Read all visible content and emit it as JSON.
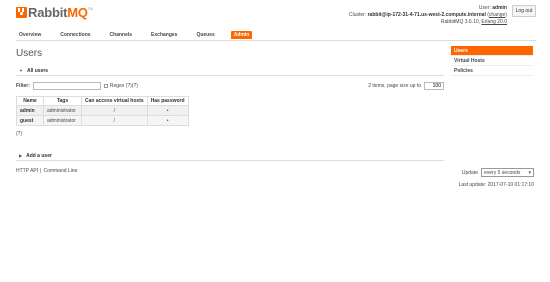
{
  "logo": {
    "text_a": "Rabbit",
    "text_b": "MQ",
    "tm": "TM"
  },
  "login": {
    "user_prefix": "User: ",
    "user": "admin",
    "cluster_prefix": "Cluster: ",
    "cluster": "rabbit@ip-172-31-4-71.us-west-2.compute.internal",
    "change_label": "change",
    "version_line": "RabbitMQ 3.6.10, ",
    "erlang": "Erlang 20.0",
    "logout_label": "Log out"
  },
  "tabs": [
    "Overview",
    "Connections",
    "Channels",
    "Exchanges",
    "Queues",
    "Admin"
  ],
  "page_title": "Users",
  "right_nav": [
    "Users",
    "Virtual Hosts",
    "Policies"
  ],
  "all_users": {
    "heading": "All users",
    "filter_label": "Filter:",
    "filter_value": "",
    "regex_label": "Regex (?)(?)",
    "items_text": "2 items, page size up to",
    "page_size": "100",
    "columns": [
      "Name",
      "Tags",
      "Can access virtual hosts",
      "Has password"
    ],
    "rows": [
      {
        "name": "admin",
        "tags": "administrator",
        "vhosts": "/",
        "has_password": "•"
      },
      {
        "name": "guest",
        "tags": "administrator",
        "vhosts": "/",
        "has_password": "•"
      }
    ],
    "help": "(?)"
  },
  "add_user": {
    "heading": "Add a user"
  },
  "footer": {
    "http_api": "HTTP API",
    "command_line": "Command Line",
    "sep": "|",
    "update_label": "Update",
    "update_value": "every 5 seconds",
    "last_update": "Last update: 2017-07-10 01:17:10"
  },
  "colors": {
    "accent": "#ff6600",
    "row_bg": "#eef0f4"
  }
}
